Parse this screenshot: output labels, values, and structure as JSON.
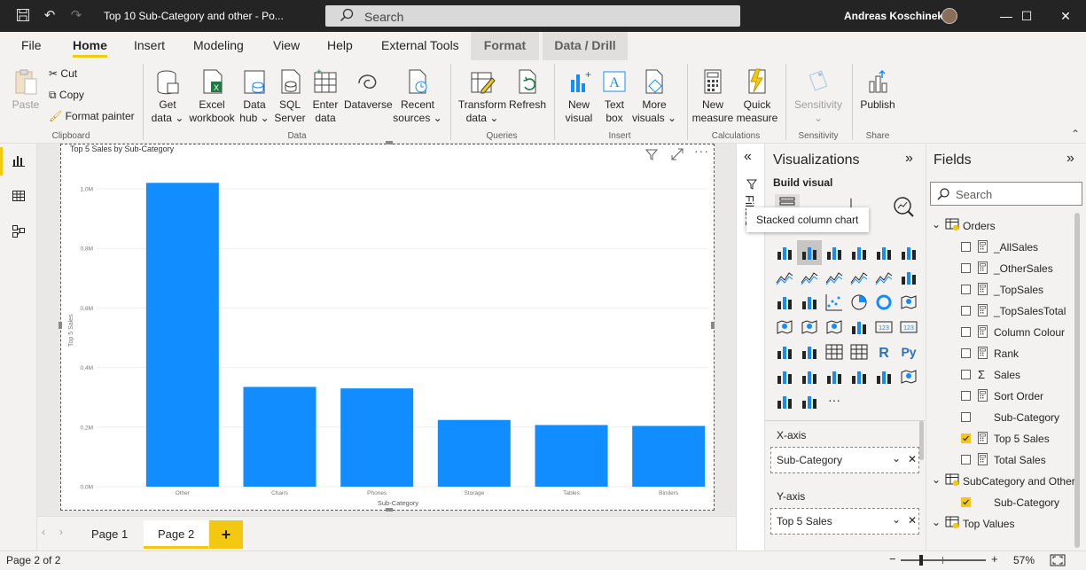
{
  "titlebar": {
    "doc_title": "Top 10 Sub-Category and other - Po...",
    "search_placeholder": "Search",
    "user_name": "Andreas Koschinek"
  },
  "ribbon_tabs": [
    "File",
    "Home",
    "Insert",
    "Modeling",
    "View",
    "Help",
    "External Tools",
    "Format",
    "Data / Drill"
  ],
  "ribbon": {
    "clipboard": {
      "paste": "Paste",
      "cut": "Cut",
      "copy": "Copy",
      "format_painter": "Format painter",
      "label": "Clipboard"
    },
    "data": {
      "get_data": [
        "Get",
        "data ⌄"
      ],
      "excel": [
        "Excel",
        "workbook"
      ],
      "data_hub": [
        "Data",
        "hub ⌄"
      ],
      "sql": [
        "SQL",
        "Server"
      ],
      "enter_data": [
        "Enter",
        "data"
      ],
      "dataverse": "Dataverse",
      "recent": [
        "Recent",
        "sources ⌄"
      ],
      "label": "Data"
    },
    "queries": {
      "transform": [
        "Transform",
        "data ⌄"
      ],
      "refresh": "Refresh",
      "label": "Queries"
    },
    "insert": {
      "new_visual": [
        "New",
        "visual"
      ],
      "text_box": [
        "Text",
        "box"
      ],
      "more_visuals": [
        "More",
        "visuals ⌄"
      ],
      "label": "Insert"
    },
    "calculations": {
      "new_measure": [
        "New",
        "measure"
      ],
      "quick_measure": [
        "Quick",
        "measure"
      ],
      "label": "Calculations"
    },
    "sensitivity": {
      "btn": [
        "Sensitivity",
        "⌄"
      ],
      "label": "Sensitivity"
    },
    "share": {
      "publish": "Publish",
      "label": "Share"
    }
  },
  "visual": {
    "title": "Top 5 Sales by Sub-Category",
    "filters_label": "Filters"
  },
  "chart_data": {
    "type": "bar",
    "title": "Top 5 Sales by Sub-Category",
    "xlabel": "Sub-Category",
    "ylabel": "Top 5 Sales",
    "categories": [
      "Other",
      "Chairs",
      "Phones",
      "Storage",
      "Tables",
      "Binders"
    ],
    "values": [
      1020000,
      335000,
      330000,
      224000,
      207000,
      204000
    ],
    "ylim": [
      0,
      1000000
    ],
    "yticks": [
      "0,0M",
      "0,2M",
      "0,4M",
      "0,6M",
      "0,8M",
      "1,0M"
    ],
    "bar_color": "#118dff",
    "grid": true
  },
  "viz_pane": {
    "title": "Visualizations",
    "build_visual": "Build visual",
    "tooltip": "Stacked column chart",
    "x_axis_label": "X-axis",
    "x_axis_field": "Sub-Category",
    "y_axis_label": "Y-axis",
    "y_axis_field": "Top 5 Sales"
  },
  "fields_pane": {
    "title": "Fields",
    "search_placeholder": "Search",
    "tables": [
      {
        "name": "Orders",
        "fields": [
          {
            "name": "_AllSales",
            "checked": false,
            "calc": true
          },
          {
            "name": "_OtherSales",
            "checked": false,
            "calc": true
          },
          {
            "name": "_TopSales",
            "checked": false,
            "calc": true
          },
          {
            "name": "_TopSalesTotal",
            "checked": false,
            "calc": true
          },
          {
            "name": "Column Colour",
            "checked": false,
            "calc": true
          },
          {
            "name": "Rank",
            "checked": false,
            "calc": true
          },
          {
            "name": "Sales",
            "checked": false,
            "sigma": true
          },
          {
            "name": "Sort Order",
            "checked": false,
            "calc": true
          },
          {
            "name": "Sub-Category",
            "checked": false
          },
          {
            "name": "Top 5 Sales",
            "checked": true,
            "calc": true
          },
          {
            "name": "Total Sales",
            "checked": false,
            "calc": true
          }
        ]
      },
      {
        "name": "SubCategory and Other",
        "fields": [
          {
            "name": "Sub-Category",
            "checked": true
          }
        ]
      },
      {
        "name": "Top Values",
        "fields": []
      }
    ]
  },
  "pages": [
    "Page 1",
    "Page 2"
  ],
  "status": {
    "page_info": "Page 2 of 2",
    "zoom": "57%"
  }
}
